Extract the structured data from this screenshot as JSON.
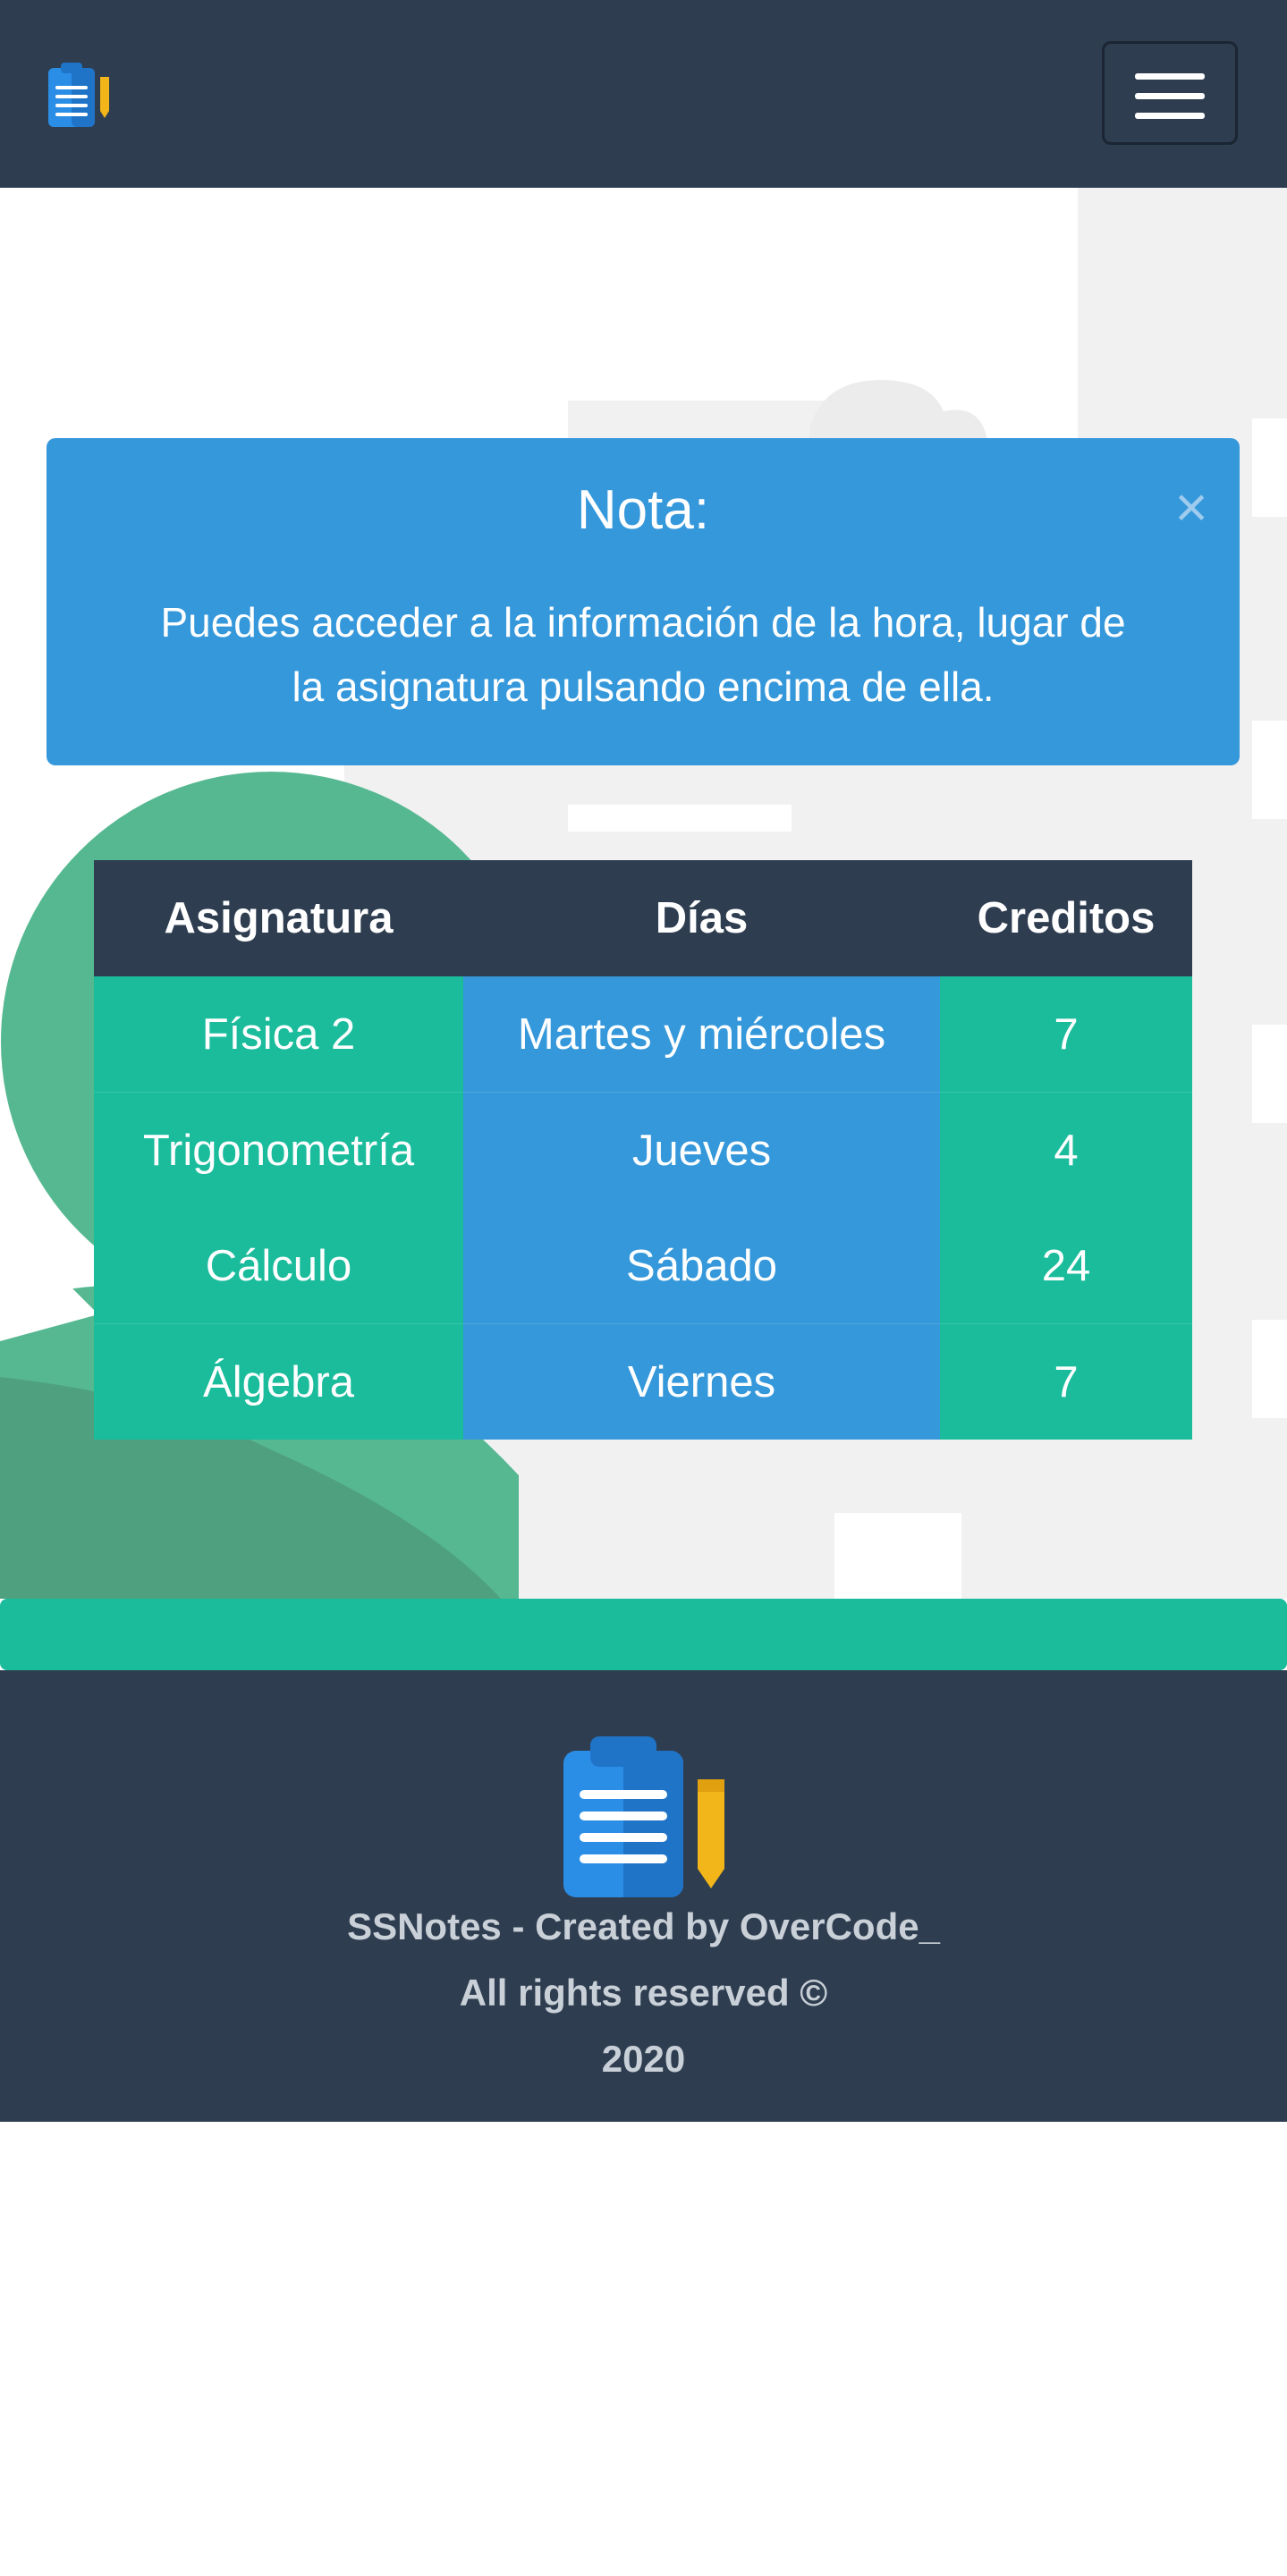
{
  "navbar": {
    "logo_icon": "notepad-pencil-icon",
    "toggle_icon": "hamburger-menu-icon"
  },
  "alert": {
    "title": "Nota:",
    "body": "Puedes acceder a la información de la hora, lugar de la asignatura pulsando encima de ella.",
    "close_label": "×",
    "color": "#3598db"
  },
  "table": {
    "headers": [
      "Asignatura",
      "Días",
      "Creditos"
    ],
    "rows": [
      {
        "subject": "Física 2",
        "days": "Martes y miércoles",
        "credits": "7"
      },
      {
        "subject": "Trigonometría",
        "days": "Jueves",
        "credits": "4"
      },
      {
        "subject": "Cálculo",
        "days": "Sábado",
        "credits": "24"
      },
      {
        "subject": "Álgebra",
        "days": "Viernes",
        "credits": "7"
      }
    ]
  },
  "footer": {
    "line1": "SSNotes - Created by OverCode_",
    "line2": "All rights reserved ©",
    "line3": "2020"
  },
  "colors": {
    "navy": "#2e3d50",
    "teal": "#1abc9c",
    "blue": "#3598db"
  }
}
